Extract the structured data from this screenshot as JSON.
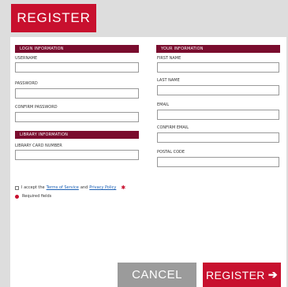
{
  "header": {
    "register_label": "REGISTER"
  },
  "login_section": {
    "title": "LOGIN INFORMATION",
    "username_label": "USERNAME",
    "password_label": "PASSWORD",
    "confirm_password_label": "CONFIRM PASSWORD"
  },
  "library_section": {
    "title": "LIBRARY INFORMATION",
    "card_number_label": "LIBRARY CARD NUMBER"
  },
  "your_section": {
    "title": "YOUR INFORMATION",
    "first_name_label": "FIRST NAME",
    "last_name_label": "LAST NAME",
    "email_label": "EMAIL",
    "confirm_email_label": "CONFIRM EMAIL",
    "postal_code_label": "POSTAL CODE"
  },
  "terms": {
    "prefix": "I accept the",
    "terms_link": "Terms of Service",
    "and": "and",
    "privacy_link": "Privacy Policy"
  },
  "required_note": "Required fields",
  "footer": {
    "cancel_label": "CANCEL",
    "register_label": "REGISTER",
    "register_arrow": "➔"
  },
  "colors": {
    "brand_red": "#c8102e",
    "section_maroon": "#7a0d2e",
    "cancel_gray": "#9b9b9b"
  }
}
